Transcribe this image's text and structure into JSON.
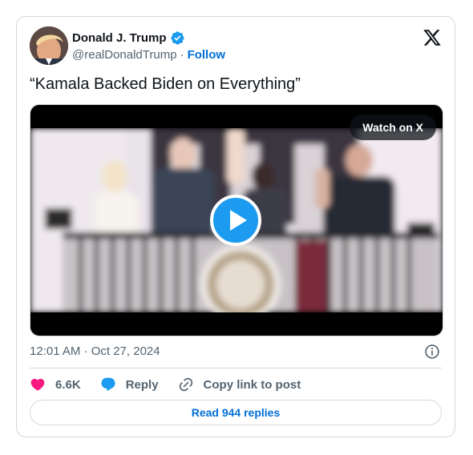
{
  "author": {
    "name": "Donald J. Trump",
    "handle": "@realDonaldTrump",
    "separator": "·",
    "follow_label": "Follow"
  },
  "tweet": {
    "text": "“Kamala Backed Biden on Everything”",
    "timestamp": "12:01 AM · Oct 27, 2024"
  },
  "media": {
    "watch_label": "Watch on X"
  },
  "actions": {
    "likes": "6.6K",
    "reply_label": "Reply",
    "copy_label": "Copy link to post",
    "read_replies_label": "Read 944 replies"
  },
  "icons": {
    "verified": "verified-badge-icon",
    "brand": "x-logo-icon",
    "play": "play-icon",
    "info": "info-icon",
    "like": "heart-icon",
    "reply": "reply-bubble-icon",
    "copy": "link-icon"
  },
  "colors": {
    "accent": "#006fd6",
    "verified": "#1d9bf0",
    "heart": "#f91880",
    "text_secondary": "#536471",
    "border": "#cfd9de"
  }
}
